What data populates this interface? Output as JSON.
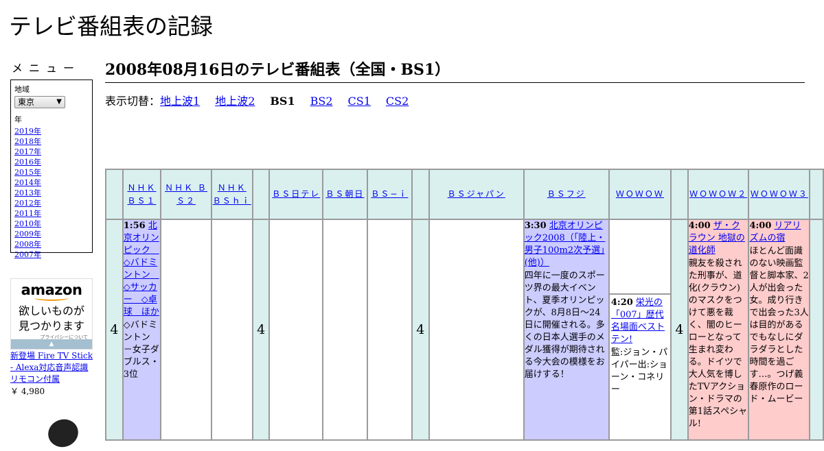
{
  "site_title": "テレビ番組表の記録",
  "sidebar": {
    "menu_heading": "メニュー",
    "region_label": "地域",
    "region_value": "東京",
    "year_label": "年",
    "years": [
      "2019年",
      "2018年",
      "2017年",
      "2016年",
      "2015年",
      "2014年",
      "2013年",
      "2012年",
      "2011年",
      "2010年",
      "2009年",
      "2008年",
      "2007年"
    ],
    "ad": {
      "logo": "amazon",
      "tagline_1": "欲しいものが",
      "tagline_2": "見つかります",
      "privacy": "プライバシーについて",
      "product": "新登場 Fire TV Stick - Alexa対応音声認識リモコン付属",
      "price": "￥ 4,980"
    }
  },
  "main": {
    "page_title": "2008年08月16日のテレビ番組表（全国・BS1）",
    "switch_label": "表示切替：",
    "switch": [
      {
        "label": "地上波1",
        "current": false
      },
      {
        "label": "地上波2",
        "current": false
      },
      {
        "label": "BS1",
        "current": true
      },
      {
        "label": "BS2",
        "current": false
      },
      {
        "label": "CS1",
        "current": false
      },
      {
        "label": "CS2",
        "current": false
      }
    ]
  },
  "schedule": {
    "hour": "4",
    "channels": {
      "nhk_bs1": "ＮＨＫ ＢＳ１",
      "nhk_bs2": "ＮＨＫ ＢＳ２",
      "nhk_bshi": "ＮＨＫ ＢＳｈｉ",
      "bs_nittele": "ＢＳ日テレ",
      "bs_asahi": "ＢＳ朝日",
      "bs_i": "ＢＳ−ｉ",
      "bs_japan": "ＢＳジャパン",
      "bs_fuji": "ＢＳフジ",
      "wowow": "ＷＯＷＯＷ",
      "wowow2": "ＷＯＷＯＷ２",
      "wowow3": "ＷＯＷＯＷ３"
    },
    "programs": {
      "bs1": {
        "time": "1:56",
        "title": "北京オリンピック　◇バドミントン　◇サッカー　◇卓球　ほか",
        "desc": "◇バドミントン　－女子ダブルス・3位"
      },
      "fuji": {
        "time": "3:30",
        "title": "北京オリンピック2008（「陸上・男子100m2次予選」(他)）",
        "desc": "四年に一度のスポーツ界の最大イベント、夏季オリンピックが、8月8日～24日に開催される。多くの日本人選手のメダル獲得が期待される今大会の模様をお届けする！"
      },
      "wowow": {
        "time": "4:20",
        "title": "栄光の「007」歴代名場面ベストテン!",
        "desc": "監:ジョン・パイパー出:ショーン・コネリー"
      },
      "wowow2": {
        "time": "4:00",
        "title": "ザ・クラウン 地獄の道化師",
        "desc": "親友を殺された刑事が、道化(クラウン)のマスクをつけて悪を裁く、闇のヒーローとなって生まれ変わる。ドイツで大人気を博したTVアクション・ドラマの第1話スペシャル!"
      },
      "wowow3": {
        "time": "4:00",
        "title": "リアリズムの宿",
        "desc": "ほとんど面識のない映画監督と脚本家、2人が出会った女。成り行きで出会った3人は目的があるでもなしにダラダラとした時間を過ごす…。つげ義春原作のロード・ムービー"
      }
    }
  }
}
